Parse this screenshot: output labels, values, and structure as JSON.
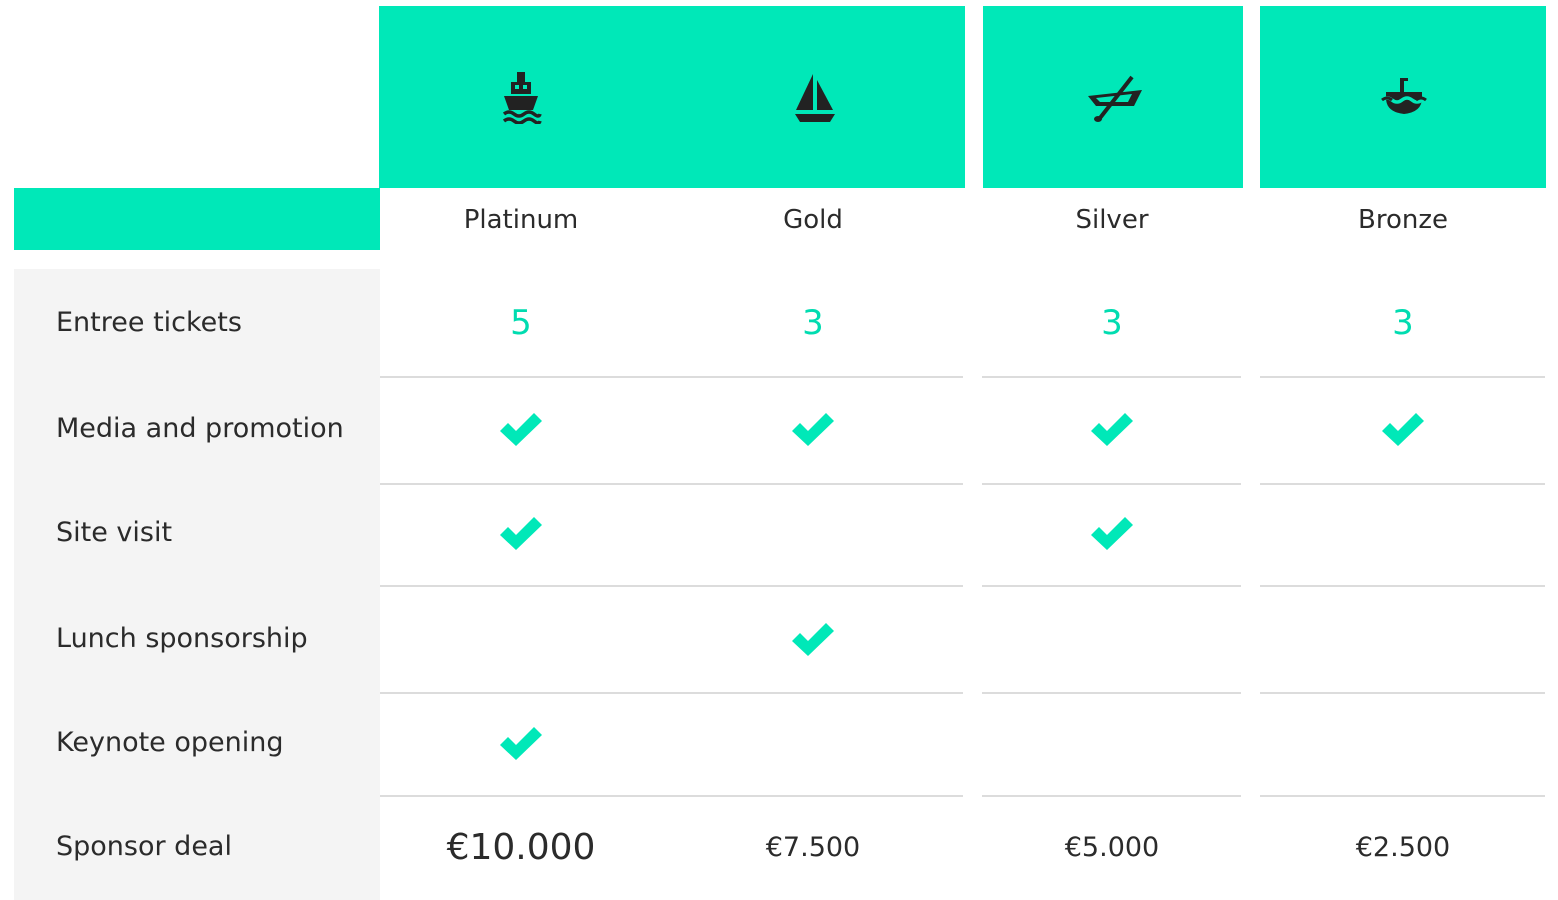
{
  "accent_color": "#00e8b8",
  "tiers": [
    {
      "name": "Platinum",
      "icon": "steamship-icon"
    },
    {
      "name": "Gold",
      "icon": "sailboat-icon"
    },
    {
      "name": "Silver",
      "icon": "rowboat-icon"
    },
    {
      "name": "Bronze",
      "icon": "submarine-icon"
    }
  ],
  "rows": [
    {
      "label": "Entree tickets",
      "values": [
        "5",
        "3",
        "3",
        "3"
      ]
    },
    {
      "label": "Media and promotion",
      "values": [
        true,
        true,
        true,
        true
      ]
    },
    {
      "label": "Site visit",
      "values": [
        true,
        false,
        true,
        false
      ]
    },
    {
      "label": "Lunch sponsorship",
      "values": [
        false,
        true,
        false,
        false
      ]
    },
    {
      "label": "Keynote opening",
      "values": [
        true,
        false,
        false,
        false
      ]
    },
    {
      "label": "Sponsor deal",
      "values": [
        "€10.000",
        "€7.500",
        "€5.000",
        "€2.500"
      ]
    }
  ]
}
